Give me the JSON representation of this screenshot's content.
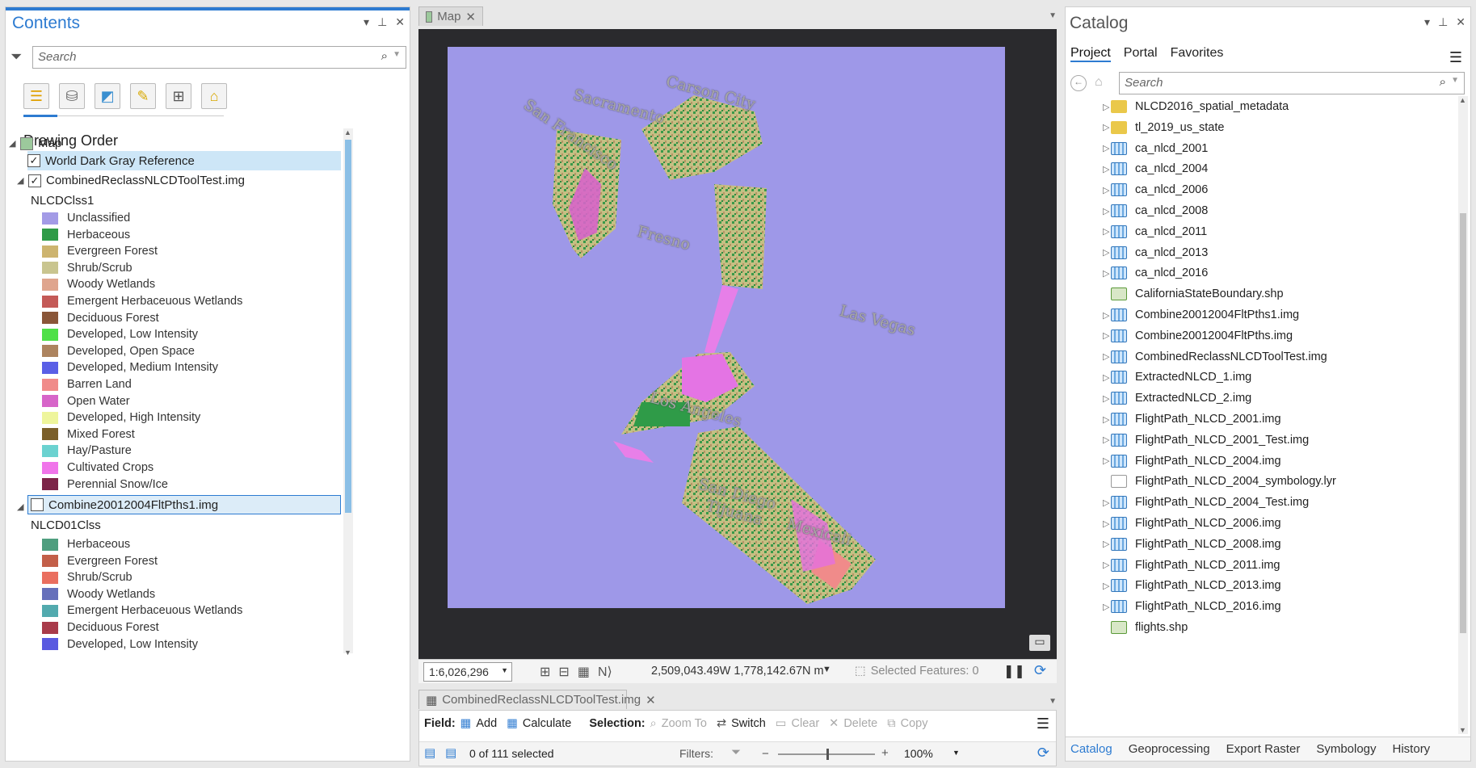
{
  "contents": {
    "title": "Contents",
    "search_placeholder": "Search",
    "heading": "Drawing Order",
    "map_label": "Map",
    "layer1": "World Dark Gray Reference",
    "layer2": "CombinedReclassNLCDToolTest.img",
    "layer2_field": "NLCDClss1",
    "legend1": [
      {
        "label": "Unclassified",
        "color": "#a39be6"
      },
      {
        "label": "Herbaceous",
        "color": "#2f9b48"
      },
      {
        "label": "Evergreen Forest",
        "color": "#cdb46f"
      },
      {
        "label": "Shrub/Scrub",
        "color": "#c9c58f"
      },
      {
        "label": "Woody Wetlands",
        "color": "#dfa58e"
      },
      {
        "label": "Emergent Herbaceuous Wetlands",
        "color": "#c45a57"
      },
      {
        "label": "Deciduous Forest",
        "color": "#8a5638"
      },
      {
        "label": "Developed, Low Intensity",
        "color": "#4fe047"
      },
      {
        "label": "Developed, Open Space",
        "color": "#ad845f"
      },
      {
        "label": "Developed, Medium Intensity",
        "color": "#5a5fe6"
      },
      {
        "label": "Barren Land",
        "color": "#f08b8a"
      },
      {
        "label": "Open Water",
        "color": "#d765c9"
      },
      {
        "label": "Developed, High Intensity",
        "color": "#eef59c"
      },
      {
        "label": "Mixed Forest",
        "color": "#7b5f2a"
      },
      {
        "label": "Hay/Pasture",
        "color": "#6bd2d0"
      },
      {
        "label": "Cultivated Crops",
        "color": "#f075ea"
      },
      {
        "label": "Perennial Snow/Ice",
        "color": "#7c2448"
      }
    ],
    "layer3": "Combine20012004FltPths1.img",
    "layer3_field": "NLCD01Clss",
    "legend2": [
      {
        "label": "Herbaceous",
        "color": "#4f9e7f"
      },
      {
        "label": "Evergreen Forest",
        "color": "#c35f49"
      },
      {
        "label": "Shrub/Scrub",
        "color": "#ea6f5f"
      },
      {
        "label": "Woody Wetlands",
        "color": "#6670bb"
      },
      {
        "label": "Emergent Herbaceuous Wetlands",
        "color": "#52aaae"
      },
      {
        "label": "Deciduous Forest",
        "color": "#a93b4a"
      },
      {
        "label": "Developed, Low Intensity",
        "color": "#5a5ae0"
      }
    ]
  },
  "map": {
    "tab_label": "Map",
    "cities": [
      "Carson City",
      "Sacramento",
      "San Francisco",
      "Fresno",
      "Las Vegas",
      "Los Angeles",
      "San Diego",
      "Tijuana",
      "Mexicali"
    ],
    "scale": "1:6,026,296",
    "coords": "2,509,043.49W 1,778,142.67N m",
    "selected_features": "Selected Features: 0"
  },
  "table": {
    "tab_label": "CombinedReclassNLCDToolTest.img",
    "field_label": "Field:",
    "add": "Add",
    "calculate": "Calculate",
    "selection_label": "Selection:",
    "zoom_to": "Zoom To",
    "switch": "Switch",
    "clear": "Clear",
    "delete": "Delete",
    "copy": "Copy",
    "selected_count": "0 of 111 selected",
    "filters": "Filters:",
    "zoom": "100%"
  },
  "catalog": {
    "title": "Catalog",
    "tabs": [
      "Project",
      "Portal",
      "Favorites"
    ],
    "search_placeholder": "Search",
    "items": [
      {
        "label": "NLCD2016_spatial_metadata",
        "icon": "folder",
        "expand": true
      },
      {
        "label": "tl_2019_us_state",
        "icon": "folder",
        "expand": true
      },
      {
        "label": "ca_nlcd_2001",
        "icon": "raster",
        "expand": true
      },
      {
        "label": "ca_nlcd_2004",
        "icon": "raster",
        "expand": true
      },
      {
        "label": "ca_nlcd_2006",
        "icon": "raster",
        "expand": true
      },
      {
        "label": "ca_nlcd_2008",
        "icon": "raster",
        "expand": true
      },
      {
        "label": "ca_nlcd_2011",
        "icon": "raster",
        "expand": true
      },
      {
        "label": "ca_nlcd_2013",
        "icon": "raster",
        "expand": true
      },
      {
        "label": "ca_nlcd_2016",
        "icon": "raster",
        "expand": true
      },
      {
        "label": "CaliforniaStateBoundary.shp",
        "icon": "shp",
        "expand": false
      },
      {
        "label": "Combine20012004FltPths1.img",
        "icon": "raster",
        "expand": true
      },
      {
        "label": "Combine20012004FltPths.img",
        "icon": "raster",
        "expand": true
      },
      {
        "label": "CombinedReclassNLCDToolTest.img",
        "icon": "raster",
        "expand": true
      },
      {
        "label": "ExtractedNLCD_1.img",
        "icon": "raster",
        "expand": true
      },
      {
        "label": "ExtractedNLCD_2.img",
        "icon": "raster",
        "expand": true
      },
      {
        "label": "FlightPath_NLCD_2001.img",
        "icon": "raster",
        "expand": true
      },
      {
        "label": "FlightPath_NLCD_2001_Test.img",
        "icon": "raster",
        "expand": true
      },
      {
        "label": "FlightPath_NLCD_2004.img",
        "icon": "raster",
        "expand": true
      },
      {
        "label": "FlightPath_NLCD_2004_symbology.lyr",
        "icon": "lyr",
        "expand": false
      },
      {
        "label": "FlightPath_NLCD_2004_Test.img",
        "icon": "raster",
        "expand": true
      },
      {
        "label": "FlightPath_NLCD_2006.img",
        "icon": "raster",
        "expand": true
      },
      {
        "label": "FlightPath_NLCD_2008.img",
        "icon": "raster",
        "expand": true
      },
      {
        "label": "FlightPath_NLCD_2011.img",
        "icon": "raster",
        "expand": true
      },
      {
        "label": "FlightPath_NLCD_2013.img",
        "icon": "raster",
        "expand": true
      },
      {
        "label": "FlightPath_NLCD_2016.img",
        "icon": "raster",
        "expand": true
      },
      {
        "label": "flights.shp",
        "icon": "shp",
        "expand": false
      }
    ],
    "bottom_tabs": [
      "Catalog",
      "Geoprocessing",
      "Export Raster",
      "Symbology",
      "History"
    ]
  }
}
